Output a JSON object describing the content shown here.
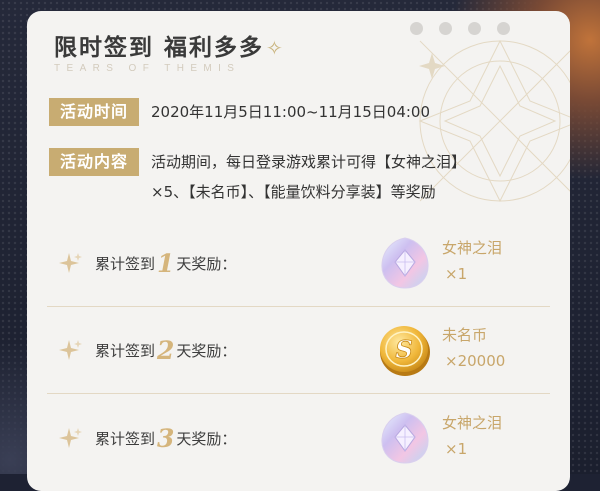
{
  "header": {
    "title": "限时签到 福利多多",
    "subtitle": "TEARS OF THEMIS"
  },
  "activity_time": {
    "label": "活动时间",
    "value": "2020年11月5日11:00~11月15日04:00"
  },
  "activity_content": {
    "label": "活动内容",
    "line1": "活动期间，每日登录游戏累计可得【女神之泪】",
    "line2": "×5、【未名币】、【能量饮料分享装】等奖励"
  },
  "rewards": [
    {
      "prefix": "累计签到",
      "day": "1",
      "suffix": "天奖励：",
      "item": "女神之泪",
      "qty": "×1",
      "icon": "crystal-icon"
    },
    {
      "prefix": "累计签到",
      "day": "2",
      "suffix": "天奖励：",
      "item": "未名币",
      "qty": "×20000",
      "icon": "coin-icon"
    },
    {
      "prefix": "累计签到",
      "day": "3",
      "suffix": "天奖励：",
      "item": "女神之泪",
      "qty": "×1",
      "icon": "crystal-icon"
    }
  ],
  "colors": {
    "accent_gold": "#c8ac72",
    "card_bg": "#f4f3f1",
    "page_bg": "#1e2233"
  }
}
